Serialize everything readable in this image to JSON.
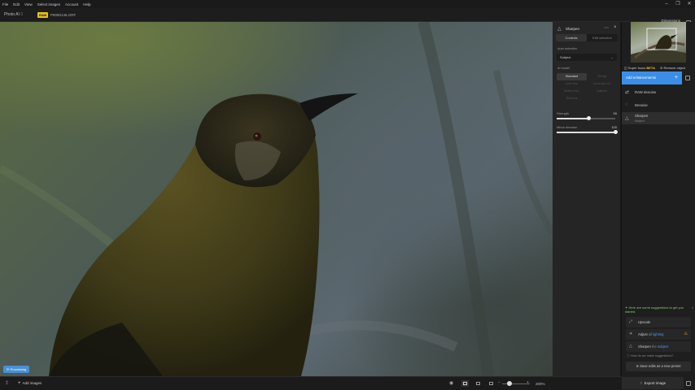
{
  "menu": [
    "File",
    "Edit",
    "View",
    "Select images",
    "Account",
    "Help"
  ],
  "app": {
    "title": "Photo AI",
    "version_mark": "3"
  },
  "file": {
    "badge": "RAW",
    "name": "P8080146.ORF"
  },
  "dimensions": {
    "label": "Dimensions",
    "value": "5243 × 3943",
    "zoom_hint": "18.8"
  },
  "status": {
    "processing": "Processing"
  },
  "panel": {
    "title": "Sharpen",
    "tabs": [
      "Controls",
      "Edit selection"
    ],
    "auto_selection_label": "Auto selection",
    "auto_selection_value": "Subject",
    "ai_model_label": "AI model",
    "models": [
      "Standard",
      "Strong",
      "Lens blur",
      "Lens blur v2",
      "Motion blur",
      "Natural",
      "Refocus"
    ],
    "strength": {
      "label": "Strength",
      "value": 55
    },
    "minor_denoise": {
      "label": "Minor denoise",
      "value": 100
    }
  },
  "right": {
    "super_focus": "Super focus",
    "beta": "BETA",
    "remove_object": "Remove object",
    "add_enhancements": "Add enhancements",
    "stack": [
      {
        "label": "RAW denoise",
        "icon": "raw-denoise-icon"
      },
      {
        "label": "Denoise",
        "icon": "denoise-icon"
      },
      {
        "label": "Sharpen",
        "sub": "Subject",
        "icon": "sharpen-icon"
      }
    ],
    "suggestions_header": "Here are some suggestions to get you started.",
    "suggestions": [
      {
        "label": "Upscale",
        "icon": "upscale-icon"
      },
      {
        "pre": "Adjust",
        "mid": "all",
        "post": "lighting",
        "icon": "lighting-icon"
      },
      {
        "pre": "Sharpen",
        "mid": "the",
        "post": "subject",
        "icon": "sharpen-icon"
      }
    ],
    "how_suggestions": "How do we make suggestions?",
    "save_preset": "Save edits as a new preset",
    "export": "Export image"
  },
  "bottom": {
    "add_images": "Add images",
    "zoom": "200%"
  },
  "colors": {
    "accent": "#3b8ee8",
    "raw_badge": "#e8c21a",
    "suggestion": "#7ed36a"
  }
}
